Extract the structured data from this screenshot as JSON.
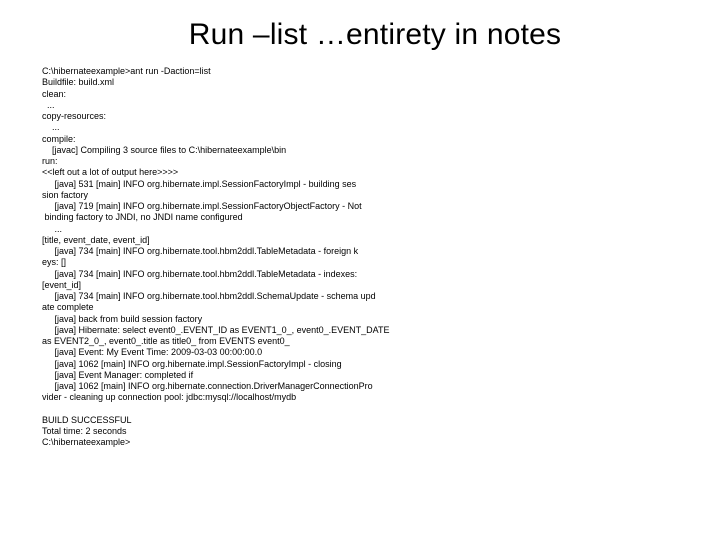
{
  "title": "Run –list …entirety in notes",
  "console_lines": [
    "C:\\hibernateexample>ant run -Daction=list",
    "Buildfile: build.xml",
    "clean:",
    "  ...",
    "copy-resources:",
    "    ...",
    "compile:",
    "    [javac] Compiling 3 source files to C:\\hibernateexample\\bin",
    "run:",
    "<<left out a lot of output here>>>>",
    "     [java] 531 [main] INFO org.hibernate.impl.SessionFactoryImpl - building ses",
    "sion factory",
    "     [java] 719 [main] INFO org.hibernate.impl.SessionFactoryObjectFactory - Not",
    " binding factory to JNDI, no JNDI name configured",
    "     ...",
    "[title, event_date, event_id]",
    "     [java] 734 [main] INFO org.hibernate.tool.hbm2ddl.TableMetadata - foreign k",
    "eys: []",
    "     [java] 734 [main] INFO org.hibernate.tool.hbm2ddl.TableMetadata - indexes:",
    "[event_id]",
    "     [java] 734 [main] INFO org.hibernate.tool.hbm2ddl.SchemaUpdate - schema upd",
    "ate complete",
    "     [java] back from build session factory",
    "     [java] Hibernate: select event0_.EVENT_ID as EVENT1_0_, event0_.EVENT_DATE",
    "as EVENT2_0_, event0_.title as title0_ from EVENTS event0_",
    "     [java] Event: My Event Time: 2009-03-03 00:00:00.0",
    "     [java] 1062 [main] INFO org.hibernate.impl.SessionFactoryImpl - closing",
    "     [java] Event Manager: completed if",
    "     [java] 1062 [main] INFO org.hibernate.connection.DriverManagerConnectionPro",
    "vider - cleaning up connection pool: jdbc:mysql://localhost/mydb",
    "",
    "BUILD SUCCESSFUL",
    "Total time: 2 seconds",
    "C:\\hibernateexample>"
  ]
}
